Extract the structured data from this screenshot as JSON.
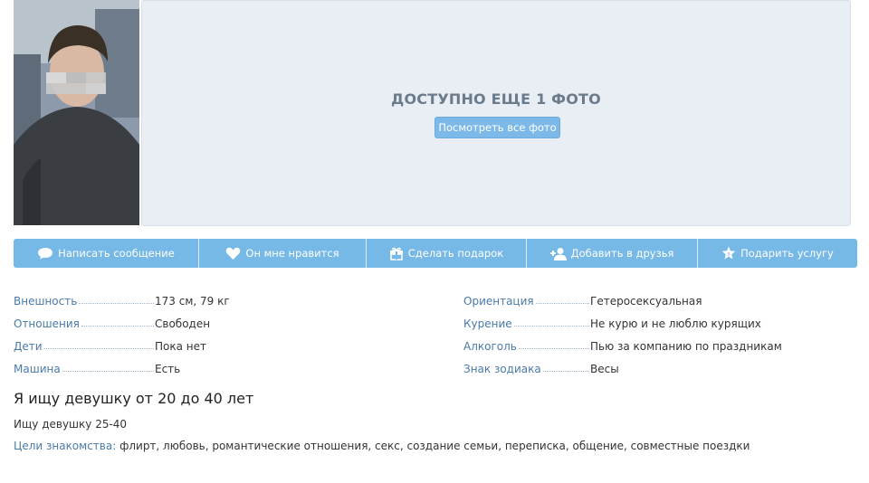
{
  "photo": {
    "alt": "profile photo"
  },
  "gallery": {
    "more_photos_text": "ДОСТУПНО ЕЩЕ 1 ФОТО",
    "view_all_label": "Посмотреть все фото",
    "panel_color": "#e8eef3"
  },
  "actions": {
    "message": "Написать сообщение",
    "like": "Он мне нравится",
    "gift": "Сделать подарок",
    "add_friend": "Добавить в друзья",
    "give_service": "Подарить услугу",
    "bar_color": "#76b8e6"
  },
  "details_left": [
    {
      "label": "Внешность",
      "value": "173 см, 79 кг"
    },
    {
      "label": "Отношения",
      "value": "Свободен"
    },
    {
      "label": "Дети",
      "value": "Пока нет"
    },
    {
      "label": "Машина",
      "value": "Есть"
    }
  ],
  "details_right": [
    {
      "label": "Ориентация",
      "value": "Гетеросексуальная"
    },
    {
      "label": "Курение",
      "value": "Не курю и не люблю курящих"
    },
    {
      "label": "Алкоголь",
      "value": "Пью за компанию по праздникам"
    },
    {
      "label": "Знак зодиака",
      "value": "Весы"
    }
  ],
  "seeking": {
    "title": "Я ищу девушку от 20 до 40 лет",
    "text": "Ищу девушку 25-40",
    "goals_label": "Цели знакомства:",
    "goals_value": "флирт, любовь, романтические отношения, секс, создание семьи, переписка, общение, совместные поездки"
  }
}
